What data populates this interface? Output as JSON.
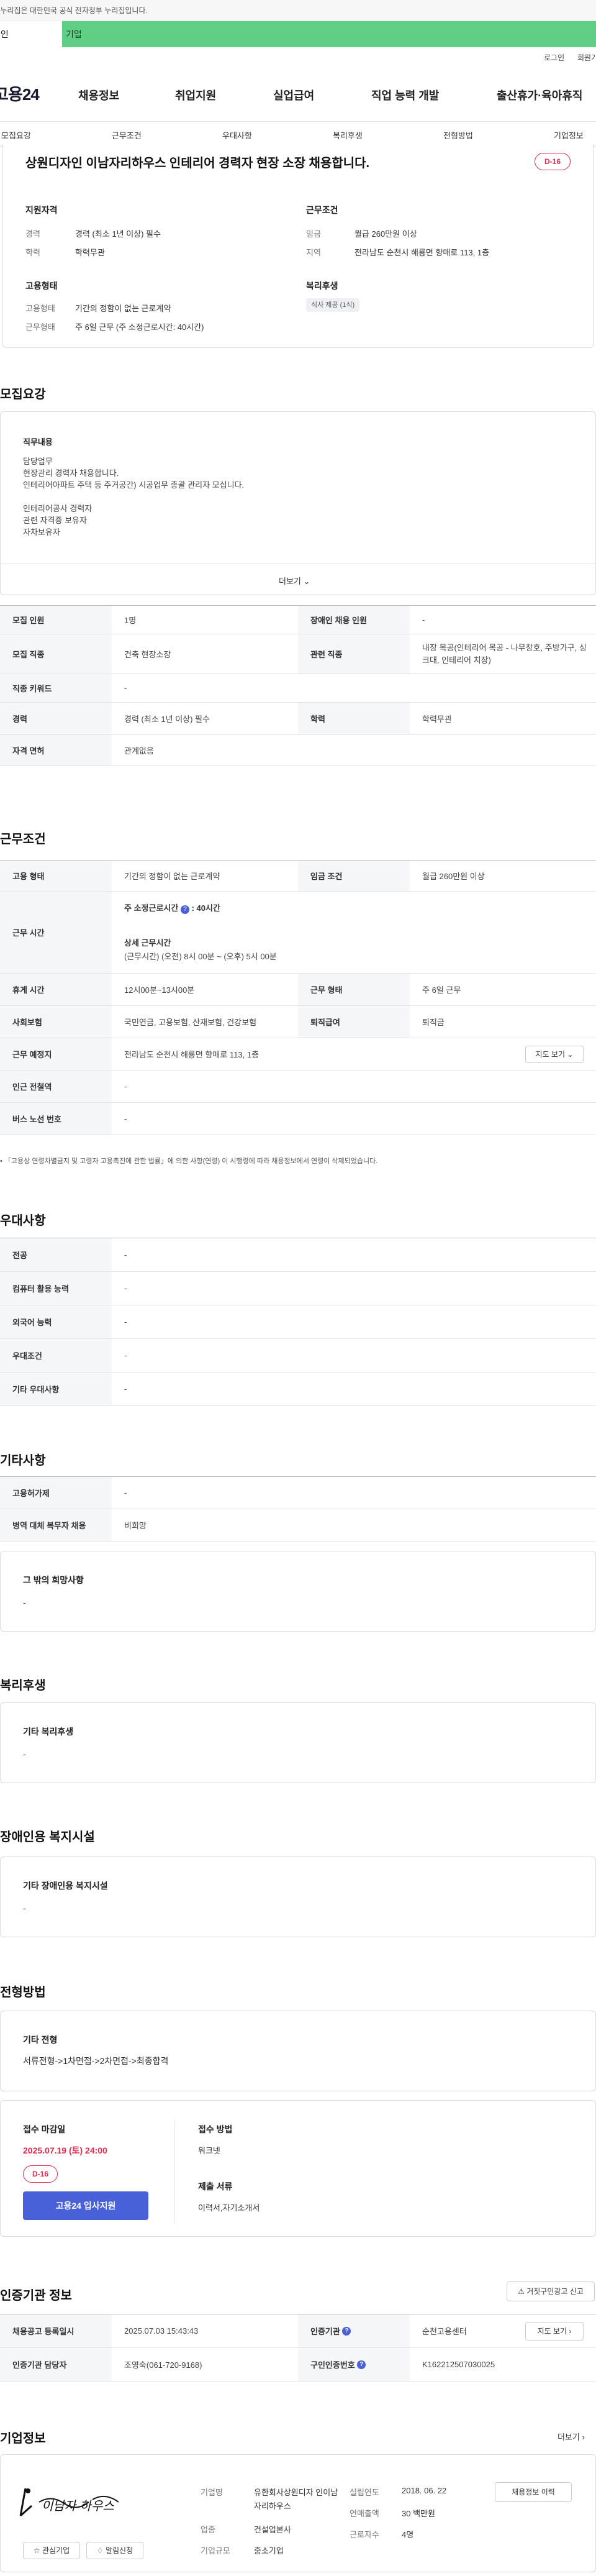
{
  "gov_notice": "이 누리집은 대한민국 공식 전자정부 누리집입니다.",
  "member_tabs": {
    "person": "개인",
    "company": "기업"
  },
  "util": {
    "login": "로그인",
    "join": "회원가입"
  },
  "header": {
    "logo": "고용24",
    "nav": [
      "채용정보",
      "취업지원",
      "실업급여",
      "직업 능력 개발",
      "출산휴가·육아휴직"
    ]
  },
  "subnav": [
    "모집요강",
    "근무조건",
    "우대사항",
    "복리후생",
    "전형방법",
    "기업정보"
  ],
  "summary": {
    "title": "상원디자인 이남자리하우스 인테리어 경력자 현장 소장 채용합니다.",
    "dday": "D-16",
    "qual_head": "지원자격",
    "qual": [
      {
        "k": "경력",
        "v": "경력 (최소 1년 이상) 필수"
      },
      {
        "k": "학력",
        "v": "학력무관"
      }
    ],
    "cond_head": "근무조건",
    "cond": [
      {
        "k": "임금",
        "v": "월급 260만원 이상"
      },
      {
        "k": "지역",
        "v": "전라남도 순천시 해룡면 향매로 113, 1층"
      }
    ],
    "emp_head": "고용형태",
    "emp": [
      {
        "k": "고용형태",
        "v": "기간의 정함이 없는 근로계약"
      },
      {
        "k": "근무형태",
        "v": "주 6일 근무 (주 소정근로시간: 40시간)"
      }
    ],
    "welfare_head": "복리후생",
    "welfare_chip": "식사 제공 (1식)"
  },
  "recruit": {
    "section_title": "모집요강",
    "duty_head": "직무내용",
    "duty_lines": [
      "담당업무",
      "현장관리 경력자 채용합니다.",
      "인테리어아파트 주택 등 주거공간) 시공업무 총괄 관리자 모십니다.",
      "",
      "인테리어공사 경력자",
      "관련 자격증 보유자",
      "자차보유자"
    ],
    "more": "더보기",
    "rows": [
      {
        "k1": "모집 인원",
        "v1": "1명",
        "k2": "장애인 채용 인원",
        "v2": "-"
      },
      {
        "k1": "모집 직종",
        "v1": "건축 현장소장",
        "k2": "관련 직종",
        "v2": "내장 목공(인테리어 목공 - 나무창호, 주방가구, 싱크대, 인테리어 치장)"
      },
      {
        "k1": "직종 키워드",
        "v1": "-"
      },
      {
        "k1": "경력",
        "v1": "경력 (최소 1년 이상) 필수",
        "k2": "학력",
        "v2": "학력무관"
      },
      {
        "k1": "자격 면허",
        "v1": "관계없음"
      }
    ]
  },
  "workcond": {
    "section_title": "근무조건",
    "emp_type_k": "고용 형태",
    "emp_type_v": "기간의 정함이 없는 근로계약",
    "wage_k": "임금 조건",
    "wage_v": "월급 260만원 이상",
    "hours_k": "근무 시간",
    "hours_main": "주 소정근로시간",
    "hours_val": ": 40시간",
    "hours_detail_head": "상세 근무시간",
    "hours_detail": "(근무시간) (오전) 8시 00분 ~ (오후) 5시 00분",
    "rest_k": "휴게 시간",
    "rest_v": "12시00분~13시00분",
    "form_k": "근무 형태",
    "form_v": "주 6일 근무",
    "ins_k": "사회보험",
    "ins_v": "국민연금, 고용보험, 산재보험, 건강보험",
    "ret_k": "퇴직급여",
    "ret_v": "퇴직금",
    "place_k": "근무 예정지",
    "place_v": "전라남도 순천시 해룡면 향매로 113, 1층",
    "map_btn": "지도 보기",
    "sub_k": "인근 전철역",
    "sub_v": "-",
    "bus_k": "버스 노선 번호",
    "bus_v": "-",
    "note": "「고용상 연령차별금지 및 고령자 고용촉진에 관한 법률」에 의한 사항(연령) 이 시행령에 따라 채용정보에서 연령이 삭제되었습니다."
  },
  "pref": {
    "section_title": "우대사항",
    "rows": [
      {
        "k": "전공",
        "v": "-"
      },
      {
        "k": "컴퓨터 활용 능력",
        "v": "-"
      },
      {
        "k": "외국어 능력",
        "v": "-"
      },
      {
        "k": "우대조건",
        "v": "-"
      },
      {
        "k": "기타 우대사항",
        "v": "-"
      }
    ]
  },
  "etc": {
    "section_title": "기타사항",
    "rows": [
      {
        "k": "고용허가제",
        "v": "-"
      },
      {
        "k": "병역 대체 복무자 채용",
        "v": "비희망"
      }
    ],
    "box_head": "그 밖의 희망사항",
    "box_val": "-"
  },
  "welfare": {
    "section_title": "복리후생",
    "box_head": "기타 복리후생",
    "box_val": "-"
  },
  "disab": {
    "section_title": "장애인용 복지시설",
    "box_head": "기타 장애인용 복지시설",
    "box_val": "-"
  },
  "process": {
    "section_title": "전형방법",
    "box_head": "기타 전형",
    "box_val": "서류전형->1차면접->2차면접->최종합격",
    "deadline_head": "접수 마감일",
    "deadline": "2025.07.19 (토) 24:00",
    "dday": "D-16",
    "apply_btn": "고용24 입사지원",
    "method_head": "접수 방법",
    "method": "워크넷",
    "docs_head": "제출 서류",
    "docs": "이력서,자기소개서"
  },
  "cert": {
    "section_title": "인증기관 정보",
    "report_btn": "거짓구인광고 신고",
    "rows": [
      {
        "k1": "채용공고 등록일시",
        "v1": "2025.07.03 15:43:43",
        "k2": "인증기관",
        "v2": "순천고용센터",
        "btn": "지도 보기"
      },
      {
        "k1": "인증기관 담당자",
        "v1": "조영숙(061-720-9168)",
        "k2": "구인인증번호",
        "v2": "K162212507030025"
      }
    ]
  },
  "company": {
    "section_title": "기업정보",
    "more": "더보기",
    "logo_text": "이남자 하우스",
    "fav_btn": "관심기업",
    "subscribe_btn": "알림신청",
    "fields": [
      {
        "k": "기업명",
        "v": "유한회사상원디자 인이남자리하우스"
      },
      {
        "k": "업종",
        "v": "건설업본사"
      },
      {
        "k": "기업규모",
        "v": "중소기업"
      }
    ],
    "fields2": [
      {
        "k": "설립연도",
        "v": "2018. 06. 22"
      },
      {
        "k": "연매출액",
        "v": "30 백만원"
      },
      {
        "k": "근로자수",
        "v": "4명"
      }
    ],
    "hire_btn": "채용정보 이력"
  }
}
